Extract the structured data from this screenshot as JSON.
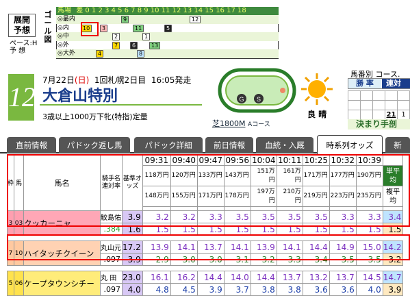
{
  "prediction": {
    "label_line1": "展開",
    "label_line2": "予想",
    "pace_label": "ペース:H",
    "pace_sub": "予 想",
    "goal_label": "ゴール図",
    "header_label": "馬場",
    "header_numbers": "差 0 1 2 3 4 5 6 7 8 9 10 11 12 13 14 15 16 17 18",
    "rows": [
      {
        "label": "◎最内",
        "markers": [
          {
            "text": "9",
            "cls": "g"
          },
          {
            "text": "12",
            "cls": ""
          }
        ]
      },
      {
        "label": "◎内",
        "markers": [
          {
            "text": "10",
            "cls": "y"
          },
          {
            "text": "3",
            "cls": "r"
          },
          {
            "text": "11",
            "cls": "g"
          },
          {
            "text": "5",
            "cls": "b"
          }
        ]
      },
      {
        "label": "◎中",
        "markers": [
          {
            "text": "2",
            "cls": ""
          },
          {
            "text": "1",
            "cls": ""
          }
        ]
      },
      {
        "label": "◎外",
        "markers": [
          {
            "text": "7",
            "cls": "y"
          },
          {
            "text": "6",
            "cls": "b"
          },
          {
            "text": "13",
            "cls": "g"
          }
        ]
      },
      {
        "label": "◎大外",
        "markers": [
          {
            "text": "4",
            "cls": "y"
          },
          {
            "text": "8",
            "cls": "c"
          }
        ]
      }
    ]
  },
  "race": {
    "number": "12",
    "date": "7月22日",
    "weekday": "(日)",
    "meeting": "1回札幌2日目",
    "start_time": "16:05発走",
    "name": "大倉山特別",
    "conditions": "3歳以上1000万下牝(特指)定量",
    "course_name": "芝1800M",
    "course_sub": "Aコース",
    "weather": "良 晴"
  },
  "right_panel": {
    "title": "馬番別 コース.",
    "tab1": "勝 率",
    "tab2": "連対",
    "calendar": [
      [
        "",
        "",
        "",
        "",
        ""
      ],
      [
        "",
        "",
        "",
        "",
        ""
      ],
      [
        "",
        "",
        "",
        "21",
        "1"
      ]
    ],
    "footer": "決まり手剖"
  },
  "nav_tabs": [
    {
      "label": "直前情報",
      "active": false
    },
    {
      "label": "パドック返し馬",
      "active": false
    },
    {
      "label": "パドック詳細",
      "active": false
    },
    {
      "label": "前日情報",
      "active": false
    },
    {
      "label": "血統・入厩",
      "active": false
    },
    {
      "label": "時系列オッズ",
      "active": true
    },
    {
      "label": "新",
      "active": false
    }
  ],
  "table": {
    "h_waku": "枠",
    "h_uma": "馬",
    "h_name": "馬名",
    "h_jockey": "騎手名連対率",
    "h_base": "基準オッズ",
    "times": [
      "09:31",
      "09:40",
      "09:47",
      "09:56",
      "10:04",
      "10:11",
      "10:25",
      "10:32",
      "10:39"
    ],
    "win_totals": [
      "118万円",
      "120万円",
      "133万円",
      "143万円",
      "151万円",
      "161万円",
      "171万円",
      "177万円",
      "190万円"
    ],
    "place_totals": [
      "148万円",
      "155万円",
      "171万円",
      "178万円",
      "197万円",
      "210万円",
      "219万円",
      "223万円",
      "235万円"
    ],
    "h_tanpei": "単平均",
    "h_fukuhei": "複平均",
    "horses": [
      {
        "waku": "3",
        "uma": "03",
        "name": "クッカーニャ",
        "jockey": "鮫島佑",
        "rate": ".384",
        "base_win": "3.9",
        "base_place": "1.6",
        "win": [
          "3.2",
          "3.2",
          "3.3",
          "3.5",
          "3.5",
          "3.5",
          "3.5",
          "3.3",
          "3.3"
        ],
        "place": [
          "1.5",
          "1.5",
          "1.5",
          "1.5",
          "1.5",
          "1.5",
          "1.5",
          "1.5",
          "1.5"
        ],
        "tanpei": "3.4",
        "fukuhei": "1.5"
      },
      {
        "waku": "7",
        "uma": "10",
        "name": "ハイタッチクイーン",
        "jockey": "丸山元",
        "rate": ".097",
        "base_win": "17.2",
        "base_place": "3.9",
        "win": [
          "13.9",
          "14.1",
          "13.7",
          "14.1",
          "13.9",
          "14.1",
          "14.4",
          "14.9",
          "15.0"
        ],
        "place": [
          "2.9",
          "3.0",
          "3.0",
          "3.1",
          "3.2",
          "3.3",
          "3.4",
          "3.5",
          "3.5"
        ],
        "tanpei": "14.2",
        "fukuhei": "3.2"
      },
      {
        "waku": "5",
        "uma": "06",
        "name": "ケープタウンシチー",
        "jockey": "丸 田",
        "rate": ".097",
        "base_win": "23.0",
        "base_place": "4.0",
        "win": [
          "16.1",
          "16.2",
          "14.4",
          "14.0",
          "14.4",
          "13.7",
          "13.2",
          "13.7",
          "14.5"
        ],
        "place": [
          "4.8",
          "4.5",
          "3.9",
          "3.7",
          "3.8",
          "3.8",
          "3.6",
          "3.6",
          "4.0"
        ],
        "tanpei": "14.7",
        "fukuhei": "3.9"
      }
    ]
  },
  "colors": {
    "waku3": "#ff9fb0",
    "waku7": "#ffc9a0",
    "waku5": "#ffe24d",
    "name3": "#ffa7b6",
    "name7": "#ffd2b3",
    "name5": "#ffec7a",
    "base_bg": "#d8c8f5",
    "grid_bg": "#eaf5d8",
    "accent": "#1a3d8c"
  }
}
